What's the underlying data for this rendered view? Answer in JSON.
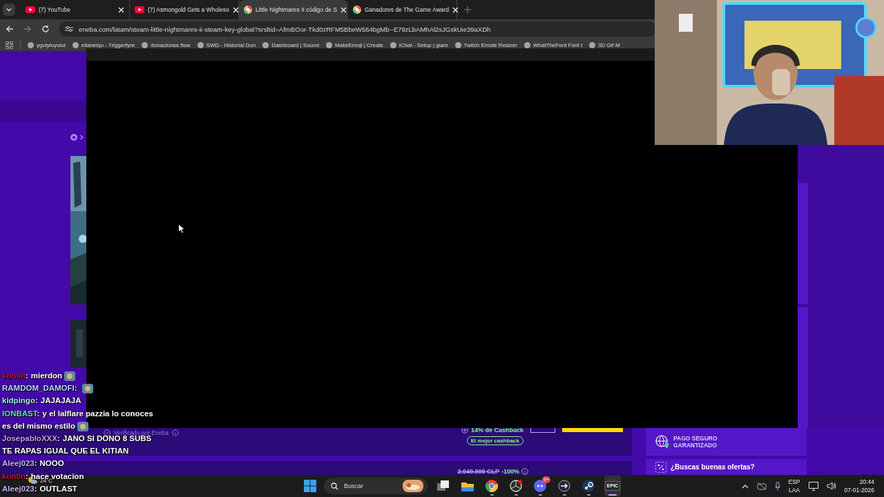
{
  "browser": {
    "tabs": [
      {
        "title": "(7) YouTube",
        "kind": "youtube",
        "selected": false
      },
      {
        "title": "(7) Asmongold Gets a Wholeso",
        "kind": "youtube",
        "selected": false
      },
      {
        "title": "Little Nightmares II código de S",
        "kind": "eneba",
        "selected": true
      },
      {
        "title": "Ganadores de The Game Award",
        "kind": "eneba",
        "selected": false
      }
    ],
    "address": "eneba.com/latam/steam-little-nightmares-ii-steam-key-global?srsltid=AfmBOor-Tkd0zRFM5BbeW564bgMb--E79zLbAMhAl2sJGxkUie39aXDh",
    "bookmarks": [
      {
        "label": "yguiytuyuiui"
      },
      {
        "label": "elianeiqu - Triggerfyre"
      },
      {
        "label": "donaciones flow"
      },
      {
        "label": "SWD - Historial Don"
      },
      {
        "label": "Dashboard | Sound"
      },
      {
        "label": "MakeEmoji | Create"
      },
      {
        "label": "iChat - Setup | giam"
      },
      {
        "label": "Twitch Emote Resizer"
      },
      {
        "label": "WhatTheFont Font I"
      },
      {
        "label": "3D Gif M"
      }
    ]
  },
  "page": {
    "verified": "Verificado por Eneba",
    "cashback": "14% de Cashback",
    "cashback_badge": "El mejor cashback",
    "old_price": "2.049.900 CLP",
    "discount": "-100%",
    "secure_payment": "PAGO SEGURO GARANTIZADO",
    "deals": "¿Buscas buenas ofertas?"
  },
  "chat": [
    {
      "user": "kon0n",
      "sep": ":",
      "color": "#d0143c",
      "lines": [
        "mierdon"
      ],
      "emote": true
    },
    {
      "user": "RAMDOM_DAMOFI",
      "sep": ":",
      "color": "#b8d8ff",
      "emote": true
    },
    {
      "user": "kidpingo",
      "sep": ":",
      "color": "#9ff0f0",
      "lines": [
        "JAJAJAJA"
      ],
      "emote": false
    },
    {
      "user": "IONBAST",
      "sep": ":",
      "color": "#5de0c0",
      "lines": [
        "y el lalflare pazzia lo conoces",
        "es del mismo estilo"
      ],
      "emote": true
    },
    {
      "user": "JosepabloXXX",
      "sep": ":",
      "color": "#c99cf0",
      "lines": [
        "JANO SI DONO 8 SUBS",
        "TE RAPAS IGUAL QUE EL KITIAN"
      ],
      "emote": false
    },
    {
      "user": "Aleej023",
      "sep": ":",
      "color": "#c8b0f8",
      "lines": [
        "NOOO"
      ],
      "emote": false
    },
    {
      "user": "kon0n",
      "sep": ":",
      "color": "#d0143c",
      "lines": [
        "hace votacion"
      ],
      "emote": false
    },
    {
      "user": "Aleej023",
      "sep": ":",
      "color": "#c8b0f8",
      "lines": [
        "OUTLAST"
      ],
      "emote": false
    }
  ],
  "taskbar": {
    "weather": "24°C",
    "search_placeholder": "Buscar",
    "apps": [
      {
        "kind": "taskview",
        "running": false,
        "selected": false
      },
      {
        "kind": "folder",
        "running": false,
        "selected": false
      },
      {
        "kind": "browser",
        "running": true,
        "selected": false
      },
      {
        "kind": "aperture",
        "running": true,
        "selected": false
      },
      {
        "kind": "chat",
        "running": true,
        "selected": false,
        "badge": "9+"
      },
      {
        "kind": "arrow",
        "running": true,
        "selected": false
      },
      {
        "kind": "steam",
        "running": true,
        "selected": false
      },
      {
        "kind": "epic",
        "running": true,
        "selected": true,
        "label": "EPIC"
      }
    ],
    "language": "ESP",
    "layout": "LAA",
    "time": "20:44",
    "date": "07-01-2026"
  }
}
